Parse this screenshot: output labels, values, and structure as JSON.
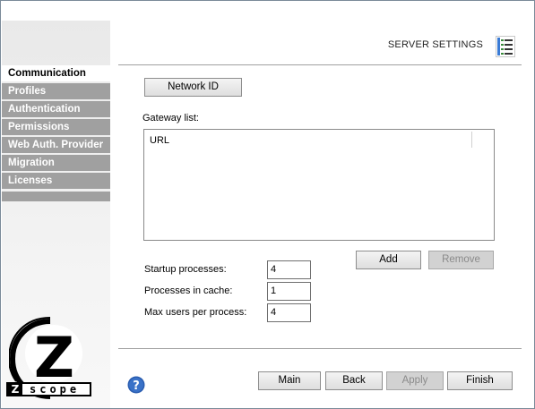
{
  "header": {
    "title": "SERVER SETTINGS",
    "icon": "settings-list-icon"
  },
  "sidebar": {
    "items": [
      {
        "label": "Communication",
        "active": true
      },
      {
        "label": "Profiles",
        "active": false
      },
      {
        "label": "Authentication",
        "active": false
      },
      {
        "label": "Permissions",
        "active": false
      },
      {
        "label": "Web Auth. Provider",
        "active": false
      },
      {
        "label": "Migration",
        "active": false
      },
      {
        "label": "Licenses",
        "active": false
      }
    ]
  },
  "logo": {
    "letter": "Z",
    "word": "scope"
  },
  "main": {
    "network_id_button": "Network ID",
    "gateway_label": "Gateway list:",
    "gateway_column_header": "URL",
    "add_button": "Add",
    "remove_button": "Remove",
    "startup_label": "Startup processes:",
    "startup_value": "4",
    "cache_label": "Processes in cache:",
    "cache_value": "1",
    "max_users_label": "Max users per process:",
    "max_users_value": "4"
  },
  "footer": {
    "main_button": "Main",
    "back_button": "Back",
    "apply_button": "Apply",
    "finish_button": "Finish",
    "help_icon": "help-icon"
  },
  "colors": {
    "sidebar_item_bg": "#a0a0a0",
    "help_blue": "#2a5db0"
  }
}
